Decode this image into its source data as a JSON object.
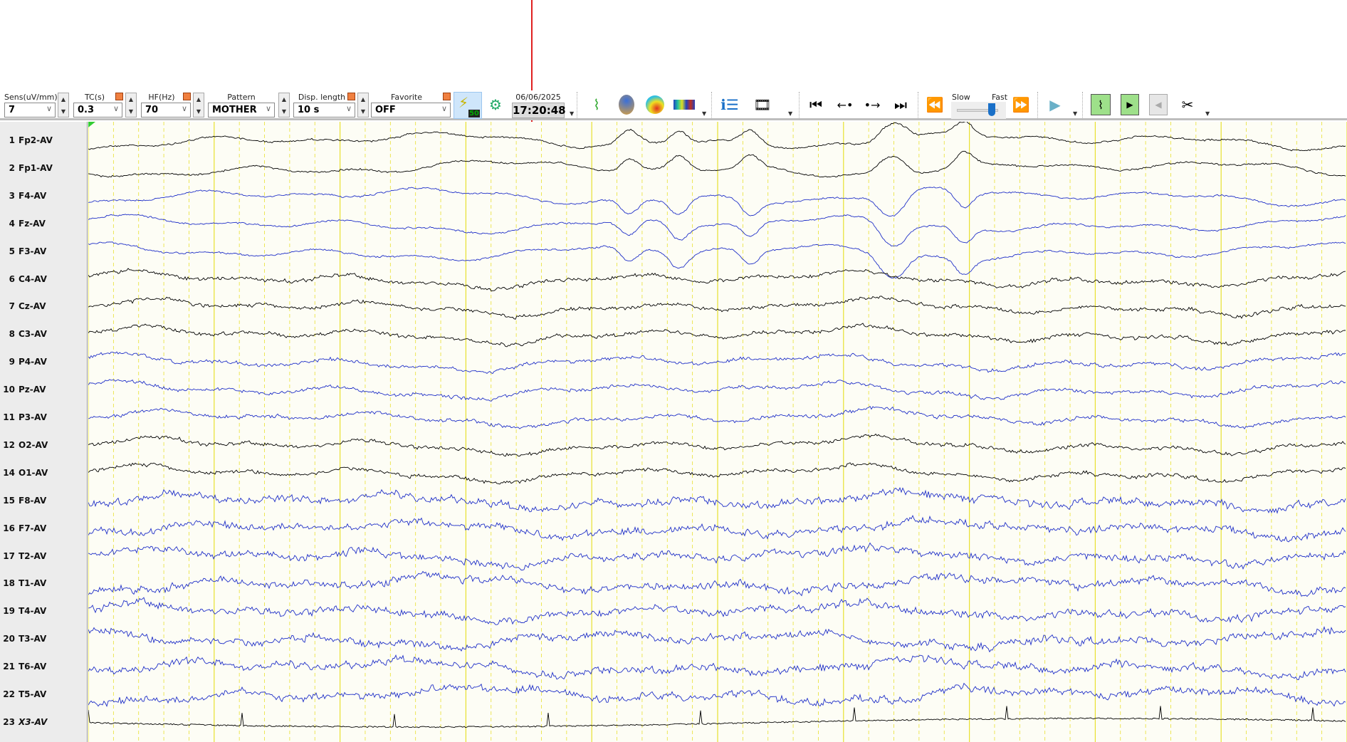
{
  "toolbar": {
    "sens": {
      "label": "Sens(uV/mm)",
      "value": "7"
    },
    "tc": {
      "label": "TC(s)",
      "value": "0.3"
    },
    "hf": {
      "label": "HF(Hz)",
      "value": "70"
    },
    "pattern": {
      "label": "Pattern",
      "value": "MOTHER"
    },
    "disp_length": {
      "label": "Disp. length",
      "value": "10 s"
    },
    "favorite": {
      "label": "Favorite",
      "value": "OFF"
    },
    "notch_badge": "50",
    "date": "06/06/2025",
    "time": "17:20:48",
    "speed_slow": "Slow",
    "speed_fast": "Fast",
    "speed_level": 0.85
  },
  "channels": [
    {
      "num": "1",
      "name": "Fp2-AV",
      "color": "#000000"
    },
    {
      "num": "2",
      "name": "Fp1-AV",
      "color": "#000000"
    },
    {
      "num": "3",
      "name": "F4-AV",
      "color": "#1f2fc8"
    },
    {
      "num": "4",
      "name": "Fz-AV",
      "color": "#1f2fc8"
    },
    {
      "num": "5",
      "name": "F3-AV",
      "color": "#1f2fc8"
    },
    {
      "num": "6",
      "name": "C4-AV",
      "color": "#000000"
    },
    {
      "num": "7",
      "name": "Cz-AV",
      "color": "#000000"
    },
    {
      "num": "8",
      "name": "C3-AV",
      "color": "#000000"
    },
    {
      "num": "9",
      "name": "P4-AV",
      "color": "#1f2fc8"
    },
    {
      "num": "10",
      "name": "Pz-AV",
      "color": "#1f2fc8"
    },
    {
      "num": "11",
      "name": "P3-AV",
      "color": "#1f2fc8"
    },
    {
      "num": "12",
      "name": "O2-AV",
      "color": "#000000"
    },
    {
      "num": "14",
      "name": "O1-AV",
      "color": "#000000"
    },
    {
      "num": "15",
      "name": "F8-AV",
      "color": "#1f2fc8"
    },
    {
      "num": "16",
      "name": "F7-AV",
      "color": "#1f2fc8"
    },
    {
      "num": "17",
      "name": "T2-AV",
      "color": "#1f2fc8"
    },
    {
      "num": "18",
      "name": "T1-AV",
      "color": "#1f2fc8"
    },
    {
      "num": "19",
      "name": "T4-AV",
      "color": "#1f2fc8"
    },
    {
      "num": "20",
      "name": "T3-AV",
      "color": "#1f2fc8"
    },
    {
      "num": "21",
      "name": "T6-AV",
      "color": "#1f2fc8"
    },
    {
      "num": "22",
      "name": "T5-AV",
      "color": "#1f2fc8"
    },
    {
      "num": "23",
      "name": "X3-AV",
      "color": "#000000"
    }
  ],
  "colors": {
    "plot_bg": "#fdfdf5",
    "grid": "#e8e030",
    "cursor": "#e02020"
  }
}
